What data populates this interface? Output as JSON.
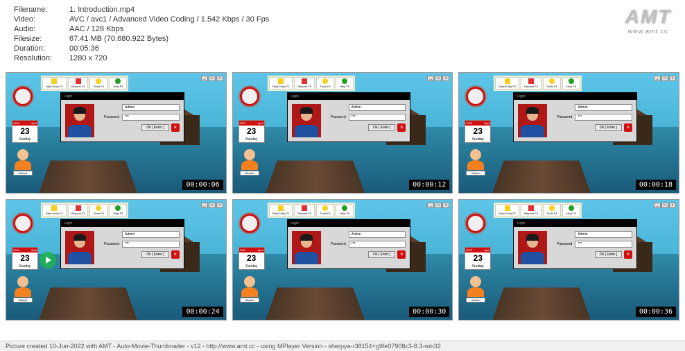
{
  "header": {
    "filename_label": "Filename:",
    "filename": "1. Introduction.mp4",
    "video_label": "Video:",
    "video": "AVC / avc1 / Advanced Video Coding / 1.542 Kbps / 30 Fps",
    "audio_label": "Audio:",
    "audio": "AAC / 128 Kbps",
    "filesize_label": "Filesize:",
    "filesize": "67.41 MB (70.680.922 Bytes)",
    "duration_label": "Duration:",
    "duration": "00:05:36",
    "resolution_label": "Resolution:",
    "resolution": "1280 x 720"
  },
  "logo": {
    "text": "AMT",
    "url": "www.amt.cc"
  },
  "toolbar": {
    "btn1": "Data Entry F2",
    "btn2": "Reports F3",
    "btn3": "Tools F4",
    "btn4": "Help F5"
  },
  "calendar": {
    "year": "2022",
    "month": "April",
    "day": "23",
    "dow": "Sunday"
  },
  "avatar": {
    "label": "Wizard"
  },
  "login": {
    "title": "Login",
    "user_label": "",
    "user_value": "Admin",
    "pass_label": "Password",
    "pass_value": "***",
    "ok": "Ok [ Enter ]"
  },
  "thumbs": [
    {
      "ts": "00:00:06",
      "playing": false
    },
    {
      "ts": "00:00:12",
      "playing": false
    },
    {
      "ts": "00:00:18",
      "playing": false
    },
    {
      "ts": "00:00:24",
      "playing": true
    },
    {
      "ts": "00:00:30",
      "playing": false
    },
    {
      "ts": "00:00:36",
      "playing": false
    }
  ],
  "footer": "Picture created 10-Jun-2022 with AMT - Auto-Movie-Thumbnailer - v12 - http://www.amt.cc - using MPlayer Version - sherpya-r38154+g9fe07908c3-8.3-win32"
}
